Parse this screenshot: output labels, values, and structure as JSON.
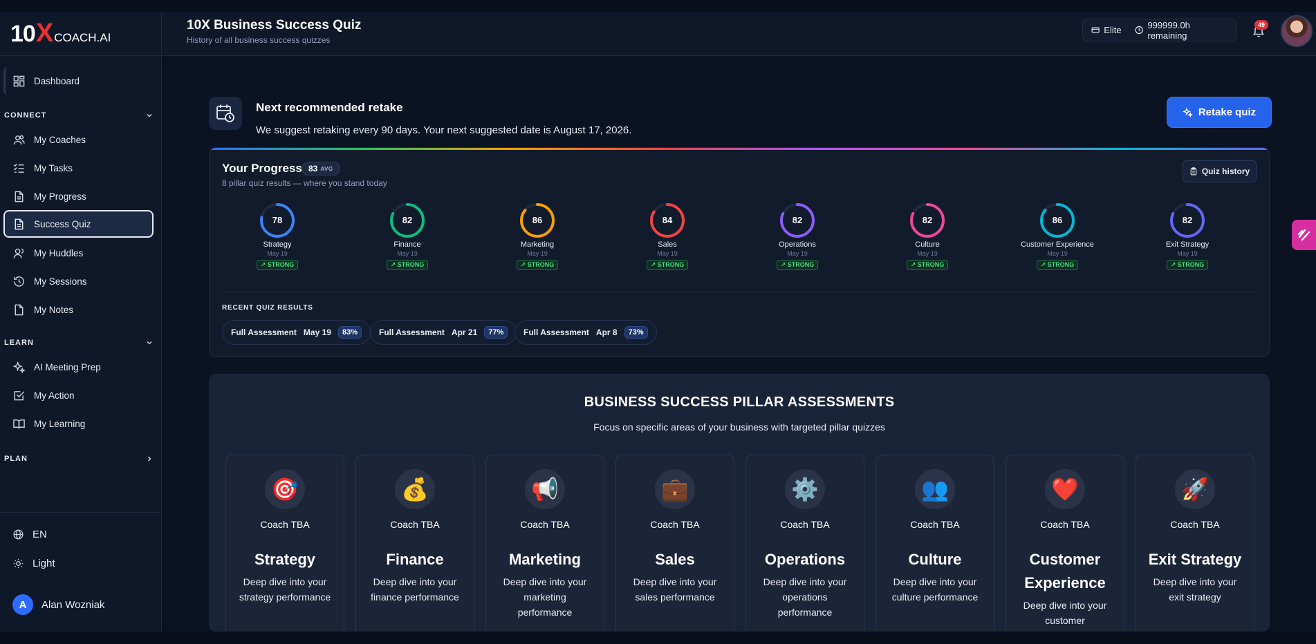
{
  "app": {
    "logo_ten": "10",
    "logo_x": "X",
    "logo_coach": "COACH.AI",
    "title": "10X Business Success Quiz",
    "subtitle": "History of all business success quizzes"
  },
  "header": {
    "plan": "Elite",
    "remaining": "999999.0h remaining",
    "notifications": "49"
  },
  "sidebar": {
    "dashboard": "Dashboard",
    "connect_label": "CONNECT",
    "connect_items": [
      "My Coaches",
      "My Tasks",
      "My Progress",
      "Success Quiz",
      "My Huddles",
      "My Sessions",
      "My Notes"
    ],
    "learn_label": "LEARN",
    "learn_items": [
      "AI Meeting Prep",
      "My Action",
      "My Learning"
    ],
    "plan_label": "PLAN",
    "language": "EN",
    "theme": "Light",
    "user_initial": "A",
    "user_name": "Alan Wozniak"
  },
  "retake": {
    "title": "Next recommended retake",
    "description": "We suggest retaking every 90 days. Your next suggested date is August 17, 2026.",
    "button": "Retake quiz"
  },
  "progress": {
    "title": "Your Progress",
    "avg_value": "83",
    "avg_label": "AVG",
    "subtitle": "8 pillar quiz results — where you stand today",
    "history_button": "Quiz history",
    "pillars": [
      {
        "score": 78,
        "name": "Strategy",
        "date": "May 19",
        "status": "STRONG",
        "color": "#3b82f6"
      },
      {
        "score": 82,
        "name": "Finance",
        "date": "May 19",
        "status": "STRONG",
        "color": "#10b981"
      },
      {
        "score": 86,
        "name": "Marketing",
        "date": "May 19",
        "status": "STRONG",
        "color": "#f59e0b"
      },
      {
        "score": 84,
        "name": "Sales",
        "date": "May 19",
        "status": "STRONG",
        "color": "#ef4444"
      },
      {
        "score": 82,
        "name": "Operations",
        "date": "May 19",
        "status": "STRONG",
        "color": "#8b5cf6"
      },
      {
        "score": 82,
        "name": "Culture",
        "date": "May 19",
        "status": "STRONG",
        "color": "#ec4899"
      },
      {
        "score": 86,
        "name": "Customer Experience",
        "date": "May 19",
        "status": "STRONG",
        "color": "#06b6d4"
      },
      {
        "score": 82,
        "name": "Exit Strategy",
        "date": "May 19",
        "status": "STRONG",
        "color": "#6366f1"
      }
    ],
    "recent_label": "RECENT QUIZ RESULTS",
    "recent": [
      {
        "name": "Full Assessment",
        "date": "May 19",
        "pct": "83%"
      },
      {
        "name": "Full Assessment",
        "date": "Apr 21",
        "pct": "77%"
      },
      {
        "name": "Full Assessment",
        "date": "Apr 8",
        "pct": "73%"
      }
    ]
  },
  "assessments": {
    "title": "BUSINESS SUCCESS PILLAR ASSESSMENTS",
    "subtitle": "Focus on specific areas of your business with targeted pillar quizzes",
    "cards": [
      {
        "icon": "🎯",
        "coach": "Coach TBA",
        "name": "Strategy",
        "desc": "Deep dive into your strategy performance"
      },
      {
        "icon": "💰",
        "coach": "Coach TBA",
        "name": "Finance",
        "desc": "Deep dive into your finance performance"
      },
      {
        "icon": "📢",
        "coach": "Coach TBA",
        "name": "Marketing",
        "desc": "Deep dive into your marketing performance"
      },
      {
        "icon": "💼",
        "coach": "Coach TBA",
        "name": "Sales",
        "desc": "Deep dive into your sales performance"
      },
      {
        "icon": "⚙️",
        "coach": "Coach TBA",
        "name": "Operations",
        "desc": "Deep dive into your operations performance"
      },
      {
        "icon": "👥",
        "coach": "Coach TBA",
        "name": "Culture",
        "desc": "Deep dive into your culture performance"
      },
      {
        "icon": "❤️",
        "coach": "Coach TBA",
        "name": "Customer Experience",
        "desc": "Deep dive into your customer"
      },
      {
        "icon": "🚀",
        "coach": "Coach TBA",
        "name": "Exit Strategy",
        "desc": "Deep dive into your exit strategy"
      }
    ]
  }
}
